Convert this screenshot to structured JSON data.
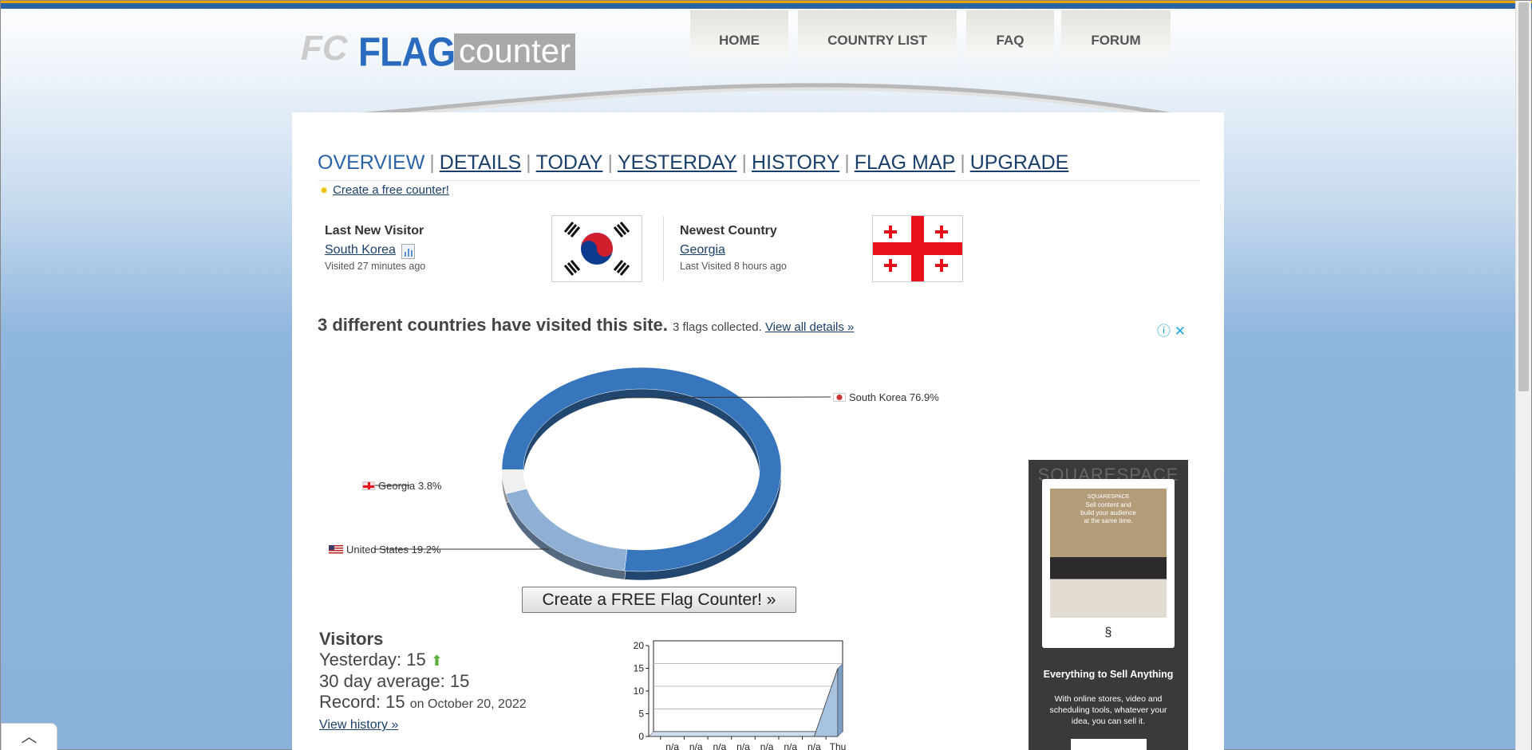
{
  "logo": {
    "text_flag": "FLAG",
    "text_counter": "counter",
    "mark": "FC"
  },
  "nav": [
    {
      "label": "HOME"
    },
    {
      "label": "COUNTRY LIST"
    },
    {
      "label": "FAQ"
    },
    {
      "label": "FORUM"
    }
  ],
  "subnav": {
    "current": "OVERVIEW",
    "links": [
      "DETAILS",
      "TODAY",
      "YESTERDAY",
      "HISTORY",
      "FLAG MAP",
      "UPGRADE"
    ]
  },
  "create_counter": "Create a free counter!",
  "last_visitor": {
    "title": "Last New Visitor",
    "country": "South Korea",
    "time": "Visited 27 minutes ago"
  },
  "newest_country": {
    "title": "Newest Country",
    "country": "Georgia",
    "time": "Last Visited 8 hours ago"
  },
  "summary": {
    "heading": "3 different countries have visited this site.",
    "flags": "3 flags collected.",
    "details_link": "View all details »"
  },
  "ad_icons": {
    "info": "ⓘ",
    "close": "✕"
  },
  "chart_data": [
    {
      "type": "pie",
      "style": "3d-donut",
      "slices": [
        {
          "name": "South Korea",
          "value": 76.9,
          "label": "South Korea  76.9%",
          "color": "#3776bd"
        },
        {
          "name": "Georgia",
          "value": 3.8,
          "label": "Georgia  3.8%",
          "color": "#f0f0f0"
        },
        {
          "name": "United States",
          "value": 19.2,
          "label": "United States  19.2%",
          "color": "#8eb0d5"
        }
      ]
    },
    {
      "type": "area",
      "categories": [
        "n/a",
        "n/a",
        "n/a",
        "n/a",
        "n/a",
        "n/a",
        "n/a",
        "Thu"
      ],
      "values": [
        0,
        0,
        0,
        0,
        0,
        0,
        0,
        15
      ],
      "ylim": [
        0,
        20
      ],
      "yticks": [
        0,
        5,
        10,
        15,
        20
      ],
      "grid": true,
      "color": "#a7c3e0"
    }
  ],
  "cta_button": "Create a FREE Flag Counter! »",
  "visitors": {
    "title": "Visitors",
    "yesterday": "Yesterday: 15",
    "average": "30 day average: 15",
    "record": "Record: 15",
    "record_date": "on October 20, 2022",
    "history_link": "View history »"
  },
  "ad": {
    "brand": "SQUARESPACE",
    "inner_headline_1": "Sell content and",
    "inner_headline_2": "build your audience",
    "inner_headline_3": "at the same time.",
    "headline": "Everything to Sell Anything",
    "body": "With online stores, video and scheduling tools, whatever your idea, you can sell it."
  },
  "scroll_up": "︿"
}
